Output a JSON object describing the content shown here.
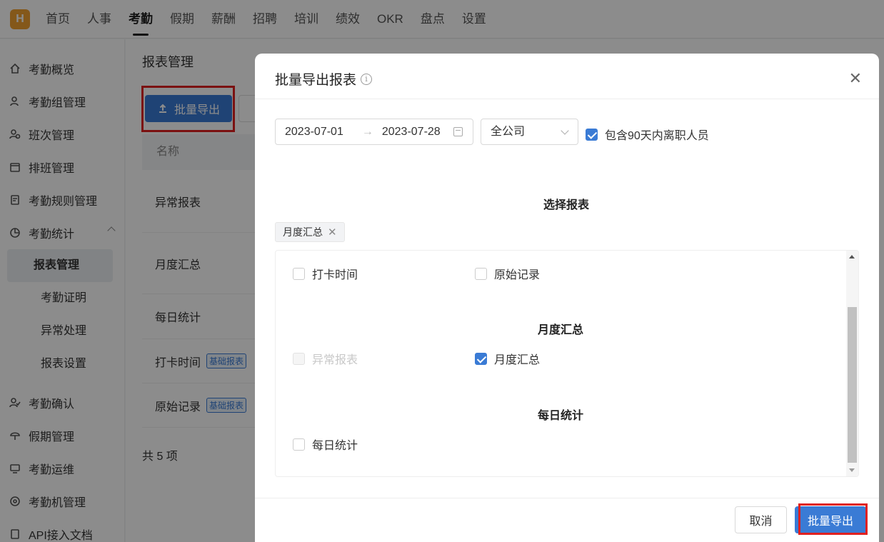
{
  "nav": {
    "logo": "H",
    "items": [
      "首页",
      "人事",
      "考勤",
      "假期",
      "薪酬",
      "招聘",
      "培训",
      "绩效",
      "OKR",
      "盘点",
      "设置"
    ],
    "active": "考勤"
  },
  "sidebar": {
    "items": [
      {
        "label": "考勤概览",
        "icon": "home-icon"
      },
      {
        "label": "考勤组管理",
        "icon": "user-group-icon"
      },
      {
        "label": "班次管理",
        "icon": "shift-icon"
      },
      {
        "label": "排班管理",
        "icon": "calendar-icon"
      },
      {
        "label": "考勤规则管理",
        "icon": "rule-icon"
      },
      {
        "label": "考勤统计",
        "icon": "chart-icon"
      }
    ],
    "sub_items": [
      "报表管理",
      "考勤证明",
      "异常处理",
      "报表设置"
    ],
    "active_sub": "报表管理",
    "bottom_items": [
      {
        "label": "考勤确认",
        "icon": "user-check-icon"
      },
      {
        "label": "假期管理",
        "icon": "umbrella-icon"
      },
      {
        "label": "考勤运维",
        "icon": "monitor-icon"
      },
      {
        "label": "考勤机管理",
        "icon": "device-icon"
      },
      {
        "label": "API接入文档",
        "icon": "doc-icon"
      }
    ]
  },
  "main": {
    "title": "报表管理",
    "export_button": "批量导出",
    "column_name": "名称",
    "rows": [
      {
        "name": "异常报表",
        "tag": ""
      },
      {
        "name": "月度汇总",
        "tag": ""
      },
      {
        "name": "每日统计",
        "tag": ""
      },
      {
        "name": "打卡时间",
        "tag": "基础报表"
      },
      {
        "name": "原始记录",
        "tag": "基础报表"
      }
    ],
    "total": "共 5 项"
  },
  "modal": {
    "title": "批量导出报表",
    "date_start": "2023-07-01",
    "date_end": "2023-07-28",
    "date_arrow": "→",
    "company": "全公司",
    "include_left_label": "包含90天内离职人员",
    "include_left_checked": true,
    "select_report_title": "选择报表",
    "chip": "月度汇总",
    "basic_options": [
      {
        "label": "打卡时间",
        "checked": false
      },
      {
        "label": "原始记录",
        "checked": false
      }
    ],
    "monthly_title": "月度汇总",
    "monthly_options": [
      {
        "label": "异常报表",
        "checked": false,
        "disabled": true
      },
      {
        "label": "月度汇总",
        "checked": true,
        "disabled": false
      }
    ],
    "daily_title": "每日统计",
    "daily_options": [
      {
        "label": "每日统计",
        "checked": false
      }
    ],
    "cancel_button": "取消",
    "export_button": "批量导出"
  },
  "colors": {
    "accent": "#3a7bd5",
    "highlight_box": "#e02020"
  }
}
